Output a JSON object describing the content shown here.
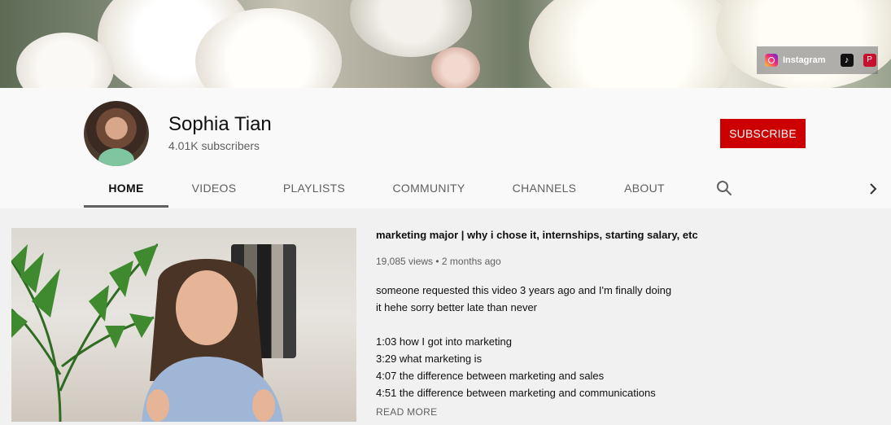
{
  "banner": {
    "links": [
      {
        "label": "Instagram",
        "icon": "instagram-icon"
      },
      {
        "label": "",
        "icon": "tiktok-icon"
      },
      {
        "label": "",
        "icon": "pinterest-icon"
      }
    ]
  },
  "channel": {
    "name": "Sophia Tian",
    "subscribers": "4.01K subscribers",
    "subscribe_label": "SUBSCRIBE",
    "subscribe_color": "#cc0000"
  },
  "tabs": [
    {
      "label": "HOME",
      "active": true
    },
    {
      "label": "VIDEOS"
    },
    {
      "label": "PLAYLISTS"
    },
    {
      "label": "COMMUNITY"
    },
    {
      "label": "CHANNELS"
    },
    {
      "label": "ABOUT"
    }
  ],
  "icons": {
    "search": "search-icon",
    "next": "chevron-right-icon"
  },
  "featured_video": {
    "title": "marketing major | why i chose it, internships, starting salary, etc",
    "meta": "19,085 views • 2 months ago",
    "description_lines": [
      "someone requested this video 3 years ago and I'm finally doing",
      "it hehe sorry better late than never",
      "",
      "1:03 how I got into marketing",
      "3:29 what marketing is",
      "4:07 the difference between marketing and sales",
      "4:51 the difference between marketing and communications"
    ],
    "read_more": "READ MORE"
  }
}
